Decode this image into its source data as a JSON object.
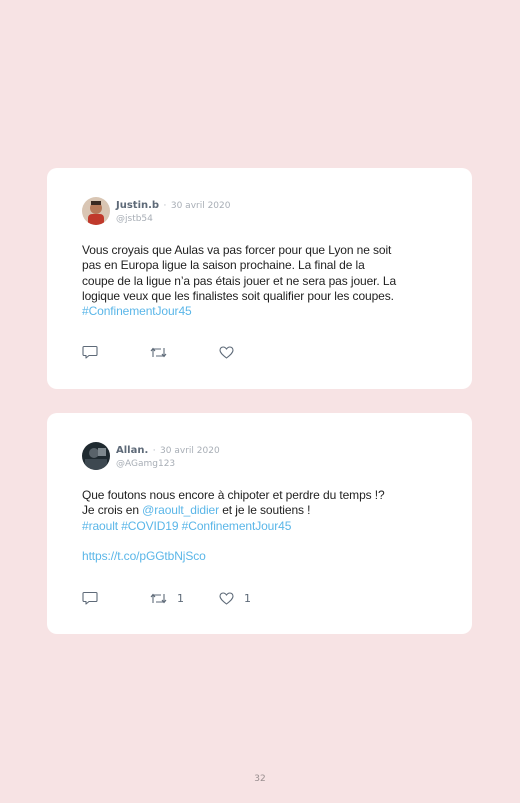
{
  "tweets": [
    {
      "name": "Justin.b",
      "dot": "·",
      "date": "30 avril 2020",
      "handle": "@jstb54",
      "avatar_icon": "user-avatar-photo",
      "lines": [
        "Vous croyais que Aulas va pas forcer pour que Lyon ne soit",
        "pas en Europa ligue la saison prochaine. La final de la",
        "coupe de la ligue n’a pas étais jouer et ne sera pas jouer. La",
        "logique veux que les finalistes soit qualifier pour les coupes."
      ],
      "hashtags": "#ConfinementJour45"
    },
    {
      "name": "Allan.",
      "dot": "·",
      "date": "30 avril 2020",
      "handle": "@AGamg123",
      "avatar_icon": "user-avatar-photo",
      "line1": "Que foutons nous encore à chipoter et perdre du temps !?",
      "line2_prefix": "Je crois en ",
      "mention": "@raoult_didier",
      "line2_suffix": " et je le soutiens !",
      "hashtags": "#raoult #COVID19 #ConfinementJour45",
      "url": "https://t.co/pGGtbNjSco",
      "retweet_count": "1",
      "like_count": "1"
    }
  ],
  "page_number": "32",
  "colors": {
    "background": "#f7e3e4",
    "card": "#ffffff",
    "link": "#5ab6e8",
    "icon": "#5e6a78"
  }
}
